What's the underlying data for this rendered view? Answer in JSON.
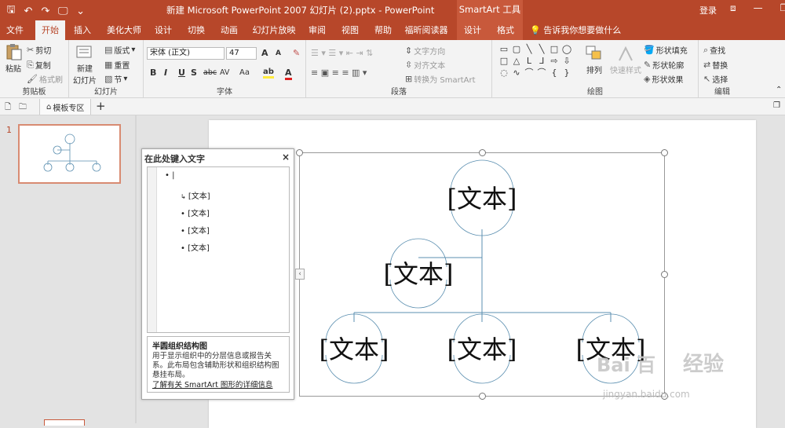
{
  "titlebar": {
    "qat": {
      "save": "🖫",
      "undo": "↶",
      "redo": "↷",
      "present": "🖵",
      "more": "⌄"
    },
    "title": "新建 Microsoft PowerPoint 2007 幻灯片 (2).pptx  -  PowerPoint",
    "context_header": "SmartArt 工具",
    "login": "登录",
    "window_buttons": {
      "ribbon_opts": "⧈",
      "minimize": "—",
      "restore": "❐"
    }
  },
  "tabs": [
    "文件",
    "开始",
    "插入",
    "美化大师",
    "设计",
    "切换",
    "动画",
    "幻灯片放映",
    "审阅",
    "视图",
    "帮助",
    "福昕阅读器",
    "设计",
    "格式"
  ],
  "tell_me": "告诉我你想要做什么",
  "ribbon": {
    "clipboard": {
      "label": "剪贴板",
      "paste": "粘贴",
      "cut": "剪切",
      "copy": "复制",
      "format_painter": "格式刷"
    },
    "slides": {
      "label": "幻灯片",
      "new_slide": "新建",
      "new_slide2": "幻灯片",
      "layout": "版式",
      "reset": "重置",
      "section": "节"
    },
    "font": {
      "label": "字体",
      "font_name": "宋体 (正文)",
      "font_size": "47",
      "grow": "A",
      "shrink": "A",
      "clear": "✎",
      "bold": "B",
      "italic": "I",
      "underline": "U",
      "strike": "S",
      "abc": "abc",
      "av": "AV",
      "aa": "Aa",
      "highlight": "ab",
      "color": "A"
    },
    "paragraph": {
      "label": "段落",
      "text_direction": "文字方向",
      "align_text": "对齐文本",
      "convert": "转换为 SmartArt"
    },
    "drawing": {
      "label": "绘图",
      "arrange": "排列",
      "quick_styles": "快速样式",
      "shape_fill": "形状填充",
      "shape_outline": "形状轮廓",
      "shape_effects": "形状效果"
    },
    "editing": {
      "label": "编辑",
      "find": "查找",
      "replace": "替换",
      "select": "选择"
    }
  },
  "subbar": {
    "template_zone": "模板专区",
    "add": "+"
  },
  "thumbnails": {
    "slide_number": "1"
  },
  "text_pane": {
    "title": "在此处键入文字",
    "close": "×",
    "items": [
      {
        "level": 0,
        "text": "|"
      },
      {
        "level": 1,
        "text": "[文本]",
        "assistant": true
      },
      {
        "level": 1,
        "text": "[文本]"
      },
      {
        "level": 1,
        "text": "[文本]"
      },
      {
        "level": 1,
        "text": "[文本]"
      }
    ],
    "desc_title": "半圆组织结构图",
    "desc_body": "用于显示组织中的分层信息或报告关系。此布局包含辅助形状和组织结构图悬挂布局。",
    "desc_link": "了解有关 SmartArt 图形的详细信息"
  },
  "smartart": {
    "nodes": [
      "[文本]",
      "[文本]",
      "[文本]",
      "[文本]",
      "[文本]"
    ],
    "line_color": "#5b8fb0"
  },
  "watermark": {
    "logo": "Bai 百",
    "text": "经验",
    "url": "jingyan.baidu.com"
  }
}
